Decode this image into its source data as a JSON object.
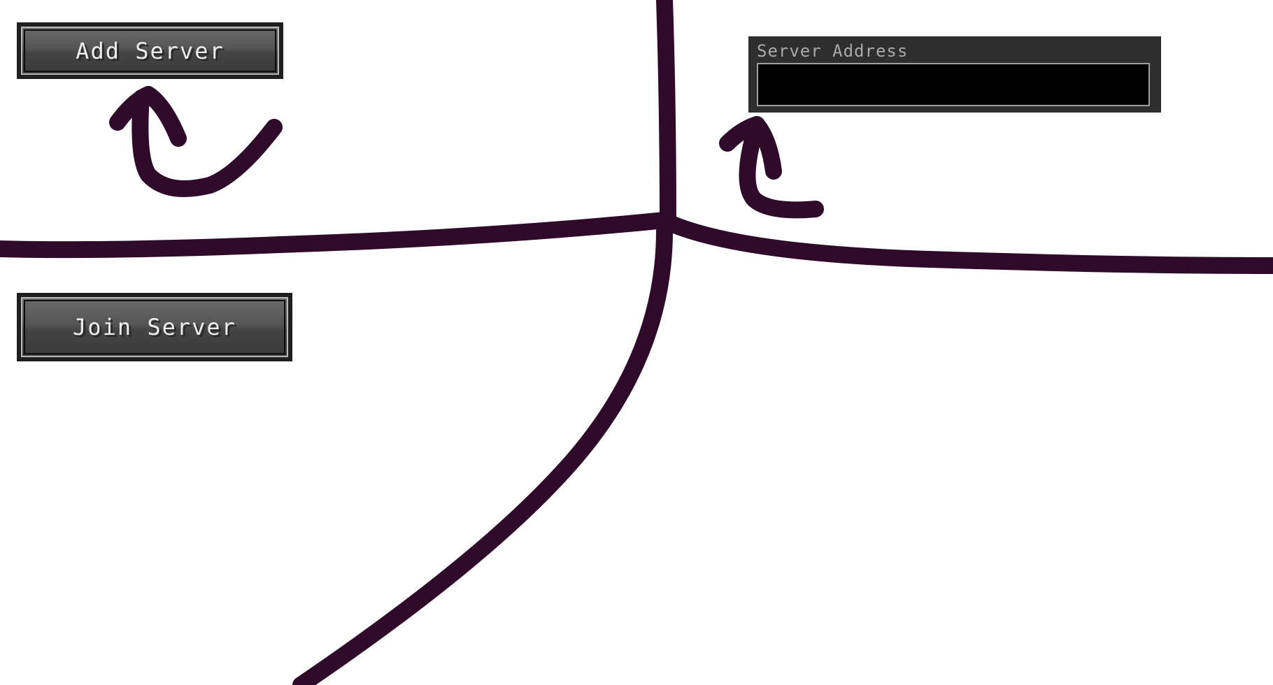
{
  "buttons": {
    "add_server": "Add Server",
    "join_server": "Join Server"
  },
  "server_address": {
    "label": "Server Address",
    "value": ""
  },
  "colors": {
    "sketch_stroke": "#2f0a2b",
    "button_face": "#4b4b4b",
    "panel_bg": "#2e2e2e",
    "input_bg": "#000000"
  }
}
